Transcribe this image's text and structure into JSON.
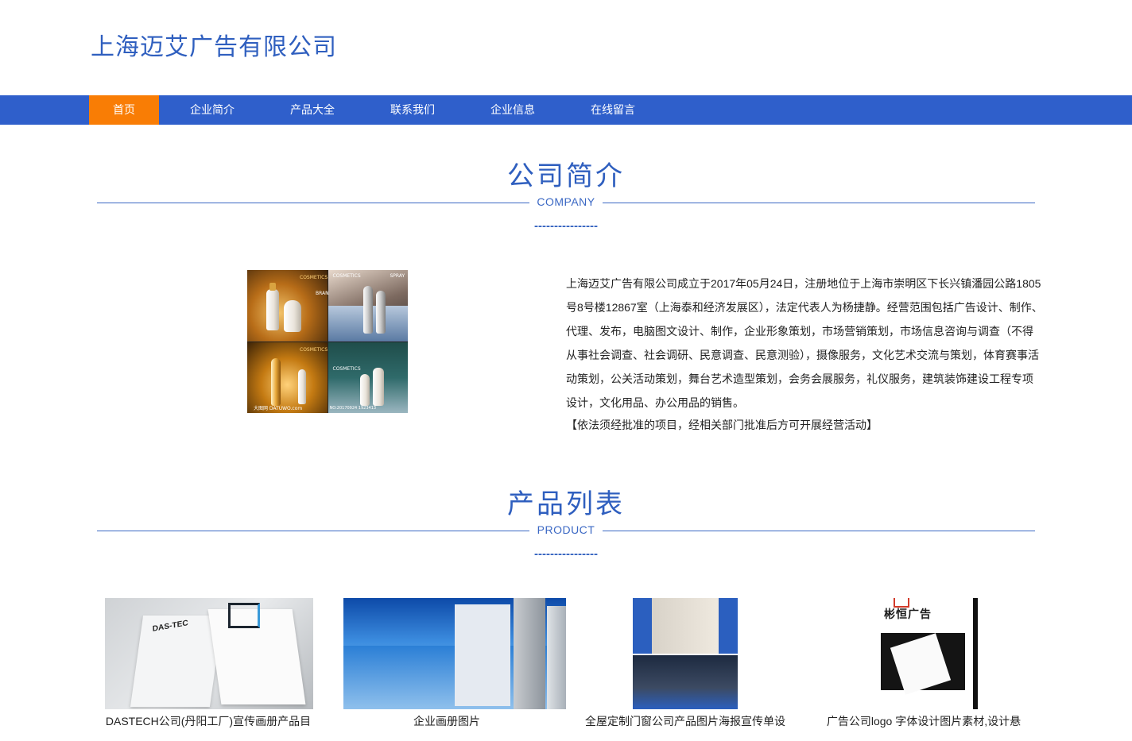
{
  "header": {
    "company_name": "上海迈艾广告有限公司"
  },
  "nav": {
    "items": [
      {
        "label": "首页",
        "active": true
      },
      {
        "label": "企业简介"
      },
      {
        "label": "产品大全"
      },
      {
        "label": "联系我们"
      },
      {
        "label": "企业信息"
      },
      {
        "label": "在线留言"
      }
    ]
  },
  "company_section": {
    "title": "公司简介",
    "subtitle": "COMPANY",
    "dash": "----------------",
    "intro_text": "上海迈艾广告有限公司成立于2017年05月24日，注册地位于上海市崇明区下长兴镇潘园公路1805号8号楼12867室（上海泰和经济发展区），法定代表人为杨捷静。经营范围包括广告设计、制作、代理、发布，电脑图文设计、制作，企业形象策划，市场营销策划，市场信息咨询与调查（不得从事社会调查、社会调研、民意调查、民意测验），摄像服务，文化艺术交流与策划，体育赛事活动策划，公关活动策划，舞台艺术造型策划，会务会展服务，礼仪服务，建筑装饰建设工程专项设计，文化用品、办公用品的销售。",
    "intro_note": "【依法须经批准的项目，经相关部门批准后方可开展经营活动】",
    "image_text": {
      "tag1": "COSMETICS",
      "tag2": "COSMETICS",
      "tag3": "COSMETICS",
      "tag4": "COSMETICS",
      "brand": "BRAND",
      "spray": "SPRAY",
      "watermark_left": "大图网 DATUWO.com",
      "watermark_right": "NO:20170924 1923413"
    }
  },
  "product_section": {
    "title": "产品列表",
    "subtitle": "PRODUCT",
    "dash": "----------------",
    "products": [
      {
        "name": "DASTECH公司(丹阳工厂)宣传画册产品目",
        "thumb_text": "DAS-TEC"
      },
      {
        "name": "企业画册图片"
      },
      {
        "name": "全屋定制门窗公司产品图片海报宣传单设"
      },
      {
        "name": "广告公司logo 字体设计图片素材,设计悬",
        "thumb_text": "彬恒广告"
      }
    ]
  },
  "colors": {
    "brand_blue": "#2f5fcb",
    "active_orange": "#f97d05"
  }
}
